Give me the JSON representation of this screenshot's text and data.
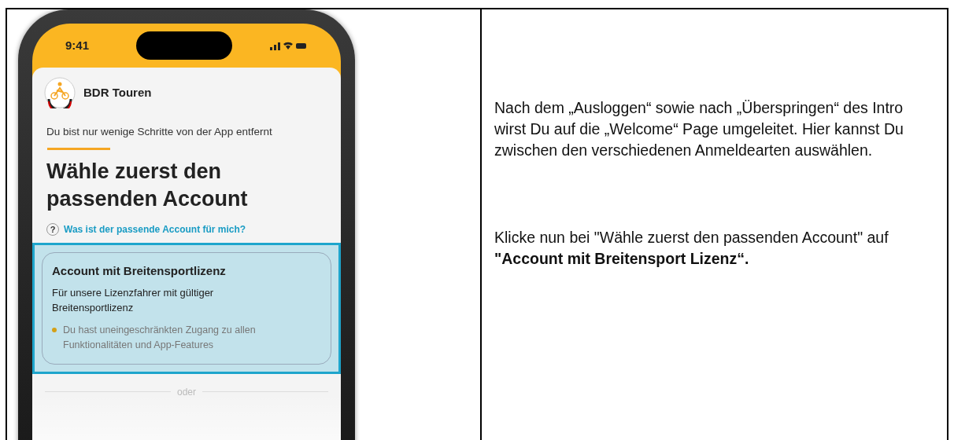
{
  "phone": {
    "status_bar": {
      "time": "9:41"
    },
    "app_name": "BDR Touren",
    "subtitle": "Du bist nur wenige Schritte von der App entfernt",
    "heading": "Wähle zuerst den passenden Account",
    "help_icon": "?",
    "help_link": "Was ist der passende Account für mich?",
    "account_option": {
      "title": "Account mit Breitensportlizenz",
      "description": "Für unsere Lizenzfahrer mit gültiger Breitensportlizenz",
      "features": [
        "Du hast uneingeschränkten Zugang zu allen Funktionalitäten und App-Features"
      ],
      "selected": true
    },
    "separator": "oder"
  },
  "instructions": [
    "Nach dem „Ausloggen“ sowie nach „Überspringen“ des Intro wirst Du auf die „Welcome“ Page umgeleitet. Hier kannst Du zwischen den verschiedenen Anmeldearten auswählen.",
    "Klicke nun bei \"Wähle zuerst den passenden Account\" auf  **\"Account mit Breitensport Lizenz“.**"
  ]
}
